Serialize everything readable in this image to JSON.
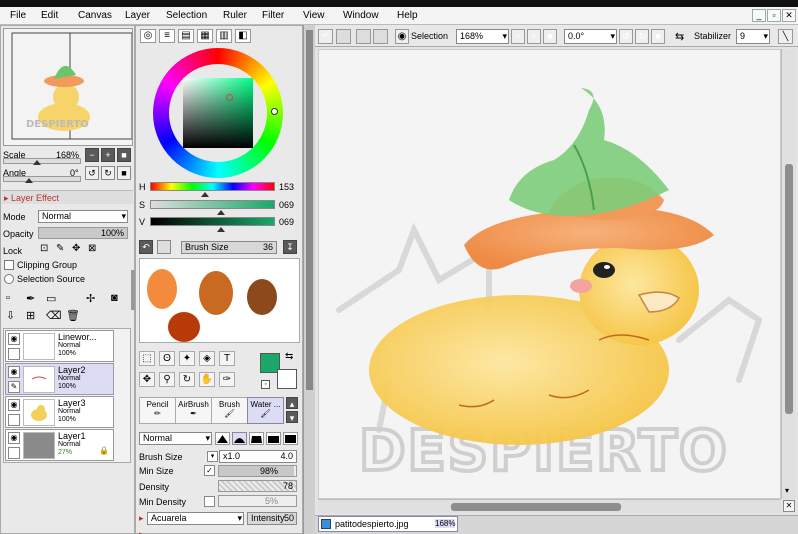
{
  "window": {
    "minimize": "_",
    "maximize": "▫",
    "close": "✕"
  },
  "menu": [
    "File",
    "Edit",
    "Canvas",
    "Layer",
    "Selection",
    "Ruler",
    "Filter",
    "View",
    "Window",
    "Help"
  ],
  "navigator": {
    "scale_label": "Scale",
    "scale_value": "168%",
    "angle_label": "Angle",
    "angle_value": "0°",
    "scale_fraction": 0.42,
    "angle_fraction": 0.32
  },
  "layer_effect": {
    "header": "Layer Effect",
    "mode_label": "Mode",
    "mode_value": "Normal",
    "opacity_label": "Opacity",
    "opacity_value": "100%",
    "lock_label": "Lock",
    "clipping": "Clipping Group",
    "selection_source": "Selection Source"
  },
  "layers": [
    {
      "name": "Linewor...",
      "mode": "Normal",
      "opacity": "100%",
      "selected": false
    },
    {
      "name": "Layer2",
      "mode": "Normal",
      "opacity": "100%",
      "selected": true
    },
    {
      "name": "Layer3",
      "mode": "Normal",
      "opacity": "100%",
      "selected": false
    },
    {
      "name": "Layer1",
      "mode": "Normal",
      "opacity": "27%",
      "selected": false
    }
  ],
  "color": {
    "h_label": "H",
    "h_value": "153",
    "s_label": "S",
    "s_value": "069",
    "v_label": "V",
    "v_value": "069",
    "current": "#1aa96a",
    "hue_fraction": 0.43,
    "sat_fraction": 0.56,
    "val_fraction": 0.56
  },
  "scratchpad": {
    "brush_size_label": "Brush Size",
    "brush_size_value": "36",
    "swatches": [
      "#f28c3c",
      "#c86a22",
      "#8c4a1c",
      "#b83a08"
    ]
  },
  "tools": {
    "text_tool": "T"
  },
  "brushes": [
    {
      "name": "Pencil",
      "selected": false
    },
    {
      "name": "AirBrush",
      "selected": false
    },
    {
      "name": "Brush",
      "selected": false
    },
    {
      "name": "Water ...",
      "selected": true
    }
  ],
  "brush_settings": {
    "blend_mode": "Normal",
    "brush_size_label": "Brush Size",
    "brush_size_mult": "x1.0",
    "brush_size_value": "4.0",
    "min_size_label": "Min Size",
    "min_size_value": "98%",
    "min_size_fraction": 0.98,
    "density_label": "Density",
    "density_value": "78",
    "min_density_label": "Min Density",
    "min_density_value": "5%",
    "texture_value": "Acuarela",
    "intensity_label": "Intensity",
    "intensity_value": "50"
  },
  "toolbar": {
    "selection_label": "Selection",
    "zoom_value": "168%",
    "rotation_value": "0.0°",
    "stabilizer_label": "Stabilizer",
    "stabilizer_value": "9"
  },
  "canvas": {
    "watermark": "DESPIERTO",
    "tab_name": "patitodespierto.jpg",
    "tab_zoom": "168%"
  }
}
